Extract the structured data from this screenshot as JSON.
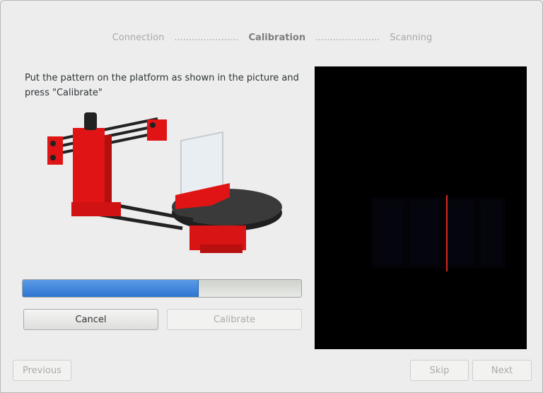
{
  "steps": {
    "connection": "Connection",
    "dots_1": "......................",
    "calibration": "Calibration",
    "dots_2": "......................",
    "scanning": "Scanning"
  },
  "instruction": "Put the pattern on the platform as shown in the picture and press \"Calibrate\"",
  "progress": {
    "value": 0.63
  },
  "buttons": {
    "cancel": "Cancel",
    "calibrate": "Calibrate",
    "previous": "Previous",
    "skip": "Skip",
    "next": "Next"
  },
  "colors": {
    "accent": "#3a80d8",
    "scanner_red": "#e01414",
    "laser_line": "#ff3020"
  },
  "icons": {
    "illustration": "scanner-with-pattern-picture",
    "camera": "camera-preview"
  }
}
